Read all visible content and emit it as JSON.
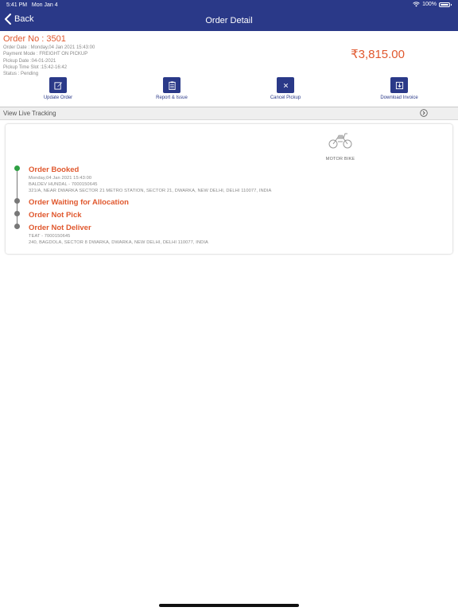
{
  "status_bar": {
    "time": "5:41 PM",
    "date": "Mon Jan 4",
    "battery": "100%"
  },
  "nav": {
    "back_label": "Back",
    "title": "Order Detail"
  },
  "order": {
    "number": "Order No : 3501",
    "meta": [
      "Order Date : Monday,04 Jan 2021 15:43:00",
      "Payment Mode : FREIGHT ON PICKUP",
      "Pickup Date :04-01-2021",
      "Pickup Time Slot :15:42-16:42",
      "Status : Pending"
    ],
    "amount": "₹3,815.00"
  },
  "actions": [
    {
      "label": "Update Order",
      "icon": "edit-icon"
    },
    {
      "label": "Report & Issue",
      "icon": "clipboard-icon"
    },
    {
      "label": "Cancel Pickup",
      "icon": "close-icon"
    },
    {
      "label": "Download Invoice",
      "icon": "download-icon"
    }
  ],
  "tracking": {
    "label": "View Live Tracking",
    "icon": "chevron-right-circle-icon"
  },
  "vehicle": {
    "label": "MOTOR BIKE",
    "icon": "motorbike-icon"
  },
  "timeline": [
    {
      "title": "Order Booked",
      "lines": [
        "Monday,04 Jan 2021 15:43:00",
        "BALDEV HUNDAL - 7000150645",
        "321/A, NEAR DWARKA SECTOR 21 METRO STATION, SECTOR 21, DWARKA, NEW DELHI, DELHI 110077, INDIA"
      ],
      "status": "done"
    },
    {
      "title": "Order Waiting for Allocation",
      "lines": [],
      "status": "pending"
    },
    {
      "title": "Order Not Pick",
      "lines": [],
      "status": "pending"
    },
    {
      "title": "Order Not Deliver",
      "lines": [
        "TEAT - 7000150645",
        "240, BAGDOLA, SECTOR 8 DWARKA, DWARKA, NEW DELHI, DELHI 110077, INDIA"
      ],
      "status": "pending"
    }
  ],
  "colors": {
    "primary": "#2a3988",
    "accent": "#e0582e",
    "done": "#2ea043",
    "pending": "#777777"
  }
}
